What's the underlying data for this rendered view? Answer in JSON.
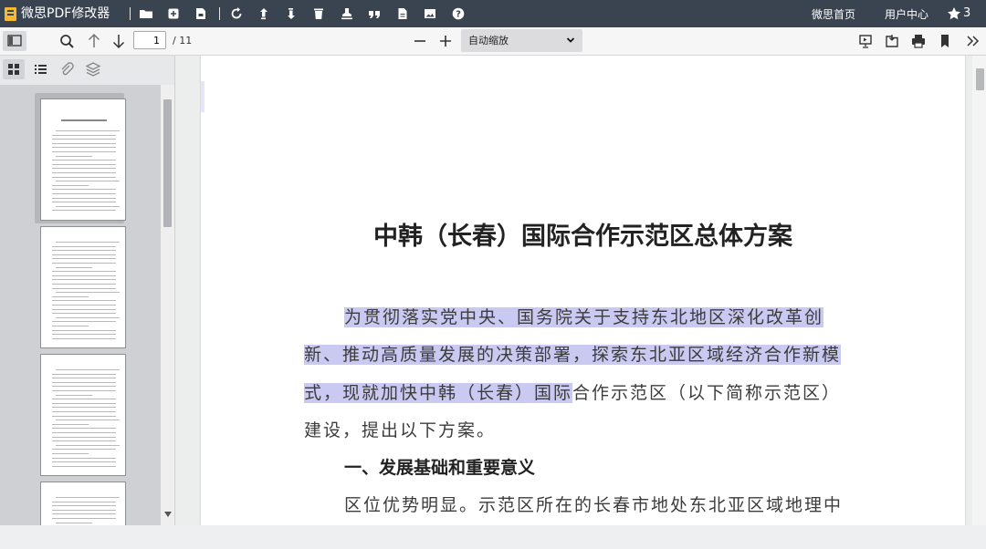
{
  "app": {
    "title": "微思PDF修改器",
    "top_links": [
      "微思首页",
      "用户中心"
    ],
    "star_count": "3",
    "accent_color": "#3a4451",
    "logo_color": "#f5b92e"
  },
  "toolbar_icons": [
    "open-folder-icon",
    "add-file-icon",
    "save-file-icon",
    "rotate-icon",
    "move-up-icon",
    "move-down-icon",
    "delete-icon",
    "stamp-icon",
    "quote-icon",
    "page-icon",
    "image-icon",
    "help-icon"
  ],
  "viewer_toolbar": {
    "current_page": "1",
    "total_pages": "/ 11",
    "zoom": "自动缩放"
  },
  "sidebar": {
    "tabs": [
      "thumbnails-icon",
      "outline-icon",
      "attachments-icon",
      "layers-icon"
    ],
    "thumbnail_count": 4,
    "thumb_title": "中韩（长春）国际合作示范区总体方案"
  },
  "document": {
    "title": "中韩（长春）国际合作示范区总体方案",
    "highlight_color": "#c9c9f1",
    "lines": [
      {
        "hl": "为贯彻落实党中央、国务院关于支持东北地区深化改革创",
        "rest": ""
      },
      {
        "hl": "新、推动高质量发展的决策部署，探索东北亚区域经济合作新模",
        "rest": ""
      },
      {
        "hl": "式，现就加快中韩（长春）国际",
        "rest": "合作示范区（以下简称示范区）"
      },
      {
        "hl": "",
        "rest": "建设，提出以下方案。"
      }
    ],
    "section_title": "一、发展基础和重要意义",
    "last_line": "区位优势明显。示范区所在的长春市地处东北亚区域地理中"
  }
}
